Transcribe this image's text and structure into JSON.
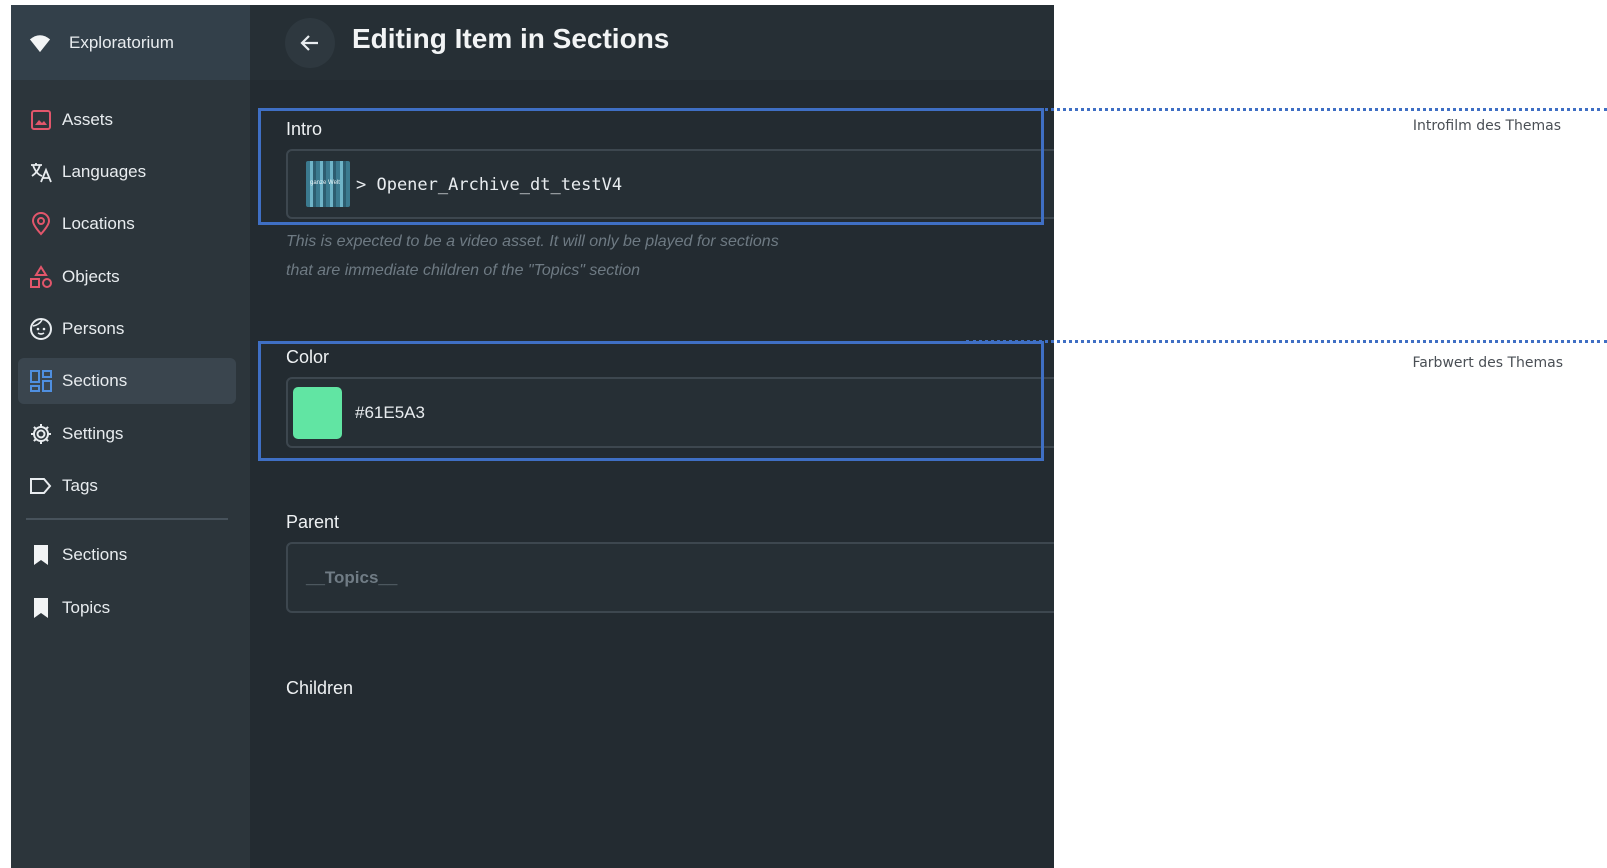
{
  "app": {
    "name": "Exploratorium"
  },
  "sidebar": {
    "items": [
      {
        "label": "Assets",
        "icon": "image-icon",
        "color": "#e2566b"
      },
      {
        "label": "Languages",
        "icon": "translate-icon",
        "color": "#e8ecef"
      },
      {
        "label": "Locations",
        "icon": "location-pin-icon",
        "color": "#e2566b"
      },
      {
        "label": "Objects",
        "icon": "shapes-icon",
        "color": "#e2566b"
      },
      {
        "label": "Persons",
        "icon": "face-icon",
        "color": "#e8ecef"
      },
      {
        "label": "Sections",
        "icon": "dashboard-icon",
        "color": "#4f8fe0",
        "active": true
      },
      {
        "label": "Settings",
        "icon": "gear-icon",
        "color": "#e8ecef"
      },
      {
        "label": "Tags",
        "icon": "tag-icon",
        "color": "#e8ecef"
      }
    ],
    "collections": [
      {
        "label": "Sections",
        "icon": "bookmark-icon"
      },
      {
        "label": "Topics",
        "icon": "bookmark-icon"
      }
    ]
  },
  "header": {
    "title": "Editing Item in Sections",
    "back_icon": "arrow-left-icon"
  },
  "form": {
    "intro": {
      "label": "Intro",
      "value": "> Opener_Archive_dt_testV4",
      "thumb_text": "ganze Welt",
      "helper_line1": "This is expected to be a video asset. It will only be played for sections",
      "helper_line2": "that are immediate children of the \"Topics\" section"
    },
    "color": {
      "label": "Color",
      "value": "#61E5A3",
      "swatch": "#61E5A3"
    },
    "parent": {
      "label": "Parent",
      "value": "__Topics__"
    },
    "children": {
      "label": "Children"
    }
  },
  "annotations": {
    "intro_note": "Introfilm des Themas",
    "color_note": "Farbwert des Themas",
    "highlight_color": "#3f6fc4"
  }
}
